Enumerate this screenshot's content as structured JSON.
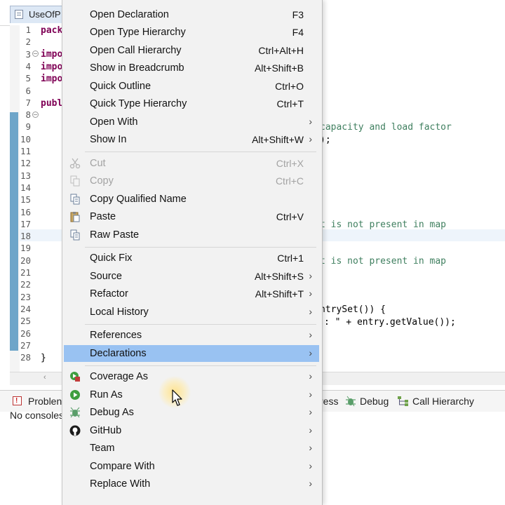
{
  "editor": {
    "tab_title": "UseOfP",
    "line_numbers": [
      "1",
      "2",
      "3",
      "4",
      "5",
      "6",
      "7",
      "8",
      "9",
      "10",
      "11",
      "12",
      "13",
      "14",
      "15",
      "16",
      "17",
      "18",
      "19",
      "20",
      "21",
      "22",
      "23",
      "24",
      "25",
      "26",
      "27",
      "28"
    ],
    "code_visible": {
      "l1": "pack",
      "l3": "impo",
      "l4": "impo",
      "l5": "impo",
      "l7": "publ",
      "l9": "capacity and load factor",
      "l10": ");",
      "l17": "t is not present in map",
      "l20": "t is not present in map",
      "l24": "ntrySet()) {",
      "l25": ": \" + entry.getValue());",
      "l28": "}"
    }
  },
  "bottom_panel": {
    "tabs": {
      "problems": "Problen",
      "progress": "ress",
      "debug": "Debug",
      "call_hierarchy": "Call Hierarchy"
    },
    "console_text": "No consoles"
  },
  "context_menu": {
    "items": [
      {
        "label": "Open Declaration",
        "shortcut": "F3"
      },
      {
        "label": "Open Type Hierarchy",
        "shortcut": "F4"
      },
      {
        "label": "Open Call Hierarchy",
        "shortcut": "Ctrl+Alt+H"
      },
      {
        "label": "Show in Breadcrumb",
        "shortcut": "Alt+Shift+B"
      },
      {
        "label": "Quick Outline",
        "shortcut": "Ctrl+O"
      },
      {
        "label": "Quick Type Hierarchy",
        "shortcut": "Ctrl+T"
      },
      {
        "label": "Open With",
        "shortcut": ""
      },
      {
        "label": "Show In",
        "shortcut": "Alt+Shift+W"
      },
      {
        "label": "Cut",
        "shortcut": "Ctrl+X",
        "disabled": true
      },
      {
        "label": "Copy",
        "shortcut": "Ctrl+C",
        "disabled": true
      },
      {
        "label": "Copy Qualified Name",
        "shortcut": ""
      },
      {
        "label": "Paste",
        "shortcut": "Ctrl+V"
      },
      {
        "label": "Raw Paste",
        "shortcut": ""
      },
      {
        "label": "Quick Fix",
        "shortcut": "Ctrl+1"
      },
      {
        "label": "Source",
        "shortcut": "Alt+Shift+S"
      },
      {
        "label": "Refactor",
        "shortcut": "Alt+Shift+T"
      },
      {
        "label": "Local History",
        "shortcut": ""
      },
      {
        "label": "References",
        "shortcut": ""
      },
      {
        "label": "Declarations",
        "shortcut": "",
        "highlighted": true
      },
      {
        "label": "Coverage As",
        "shortcut": ""
      },
      {
        "label": "Run As",
        "shortcut": ""
      },
      {
        "label": "Debug As",
        "shortcut": ""
      },
      {
        "label": "GitHub",
        "shortcut": ""
      },
      {
        "label": "Team",
        "shortcut": ""
      },
      {
        "label": "Compare With",
        "shortcut": ""
      },
      {
        "label": "Replace With",
        "shortcut": ""
      }
    ],
    "submenu_glyph": "›"
  },
  "colors": {
    "menu_highlight": "#99c2f2",
    "keyword": "#7f0055",
    "comment": "#3f7f5f",
    "change_ruler": "#6ea5c9"
  }
}
